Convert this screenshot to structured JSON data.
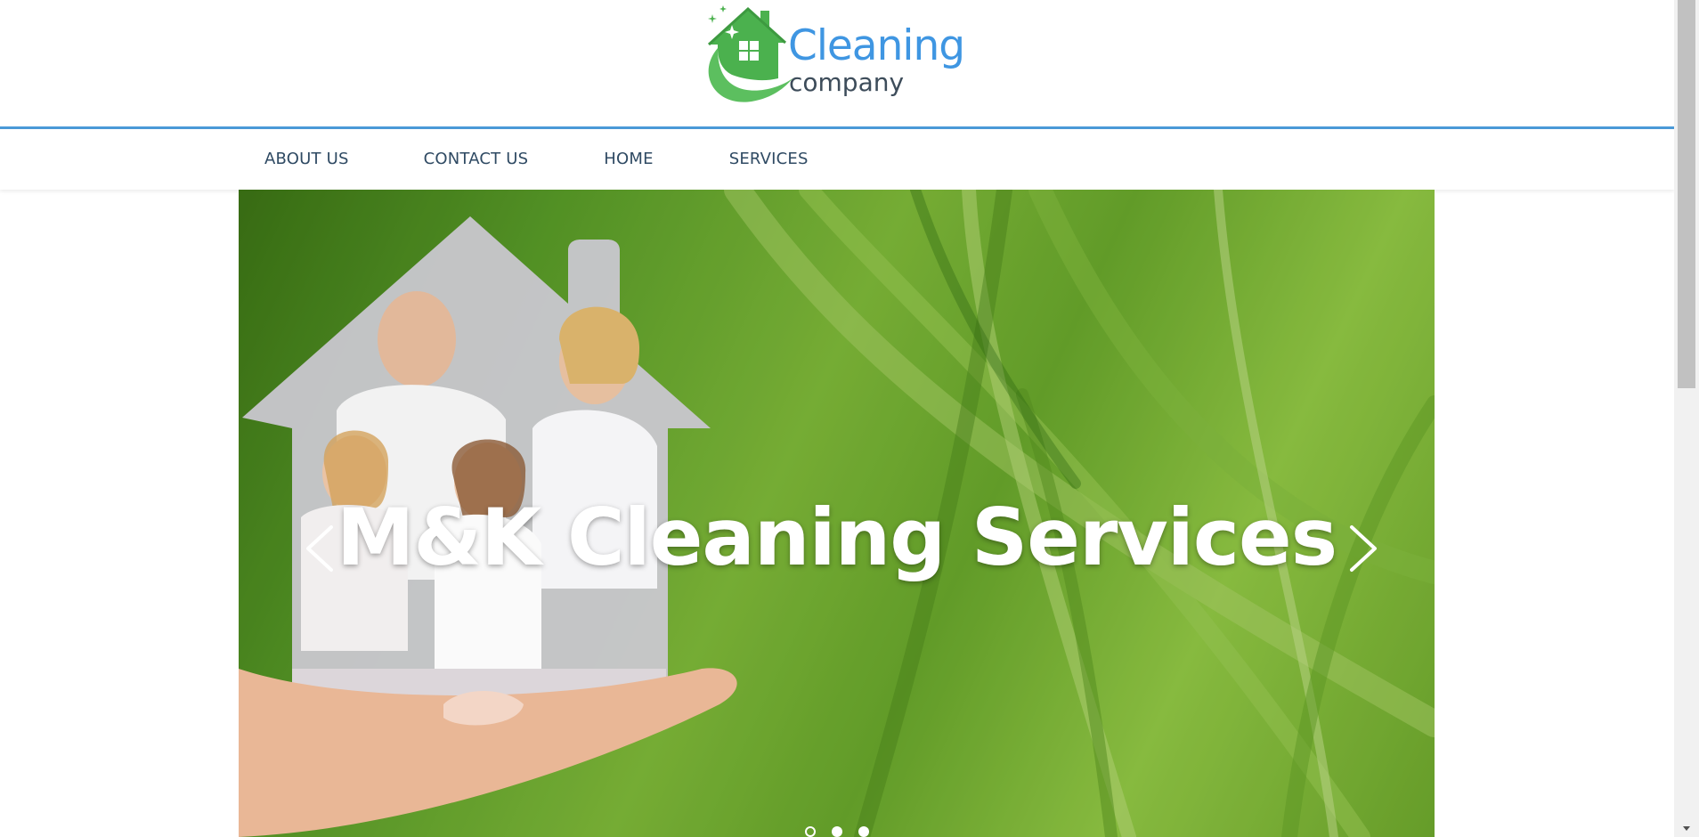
{
  "brand": {
    "logo_word1": "Cleaning",
    "logo_word2": "company",
    "logo_icon": "house-sparkle-logo-icon",
    "primary_color": "#3f96e2",
    "accent_green": "#4caf50"
  },
  "nav": {
    "items": [
      {
        "label": "ABOUT US"
      },
      {
        "label": "CONTACT US"
      },
      {
        "label": "HOME"
      },
      {
        "label": "SERVICES"
      }
    ],
    "text_color": "#2f4a63",
    "rule_color": "#4a9ad8"
  },
  "hero": {
    "title": "M&K Cleaning Services",
    "prev_icon": "chevron-left-icon",
    "next_icon": "chevron-right-icon",
    "slides_count": 3,
    "active_slide": 1
  }
}
